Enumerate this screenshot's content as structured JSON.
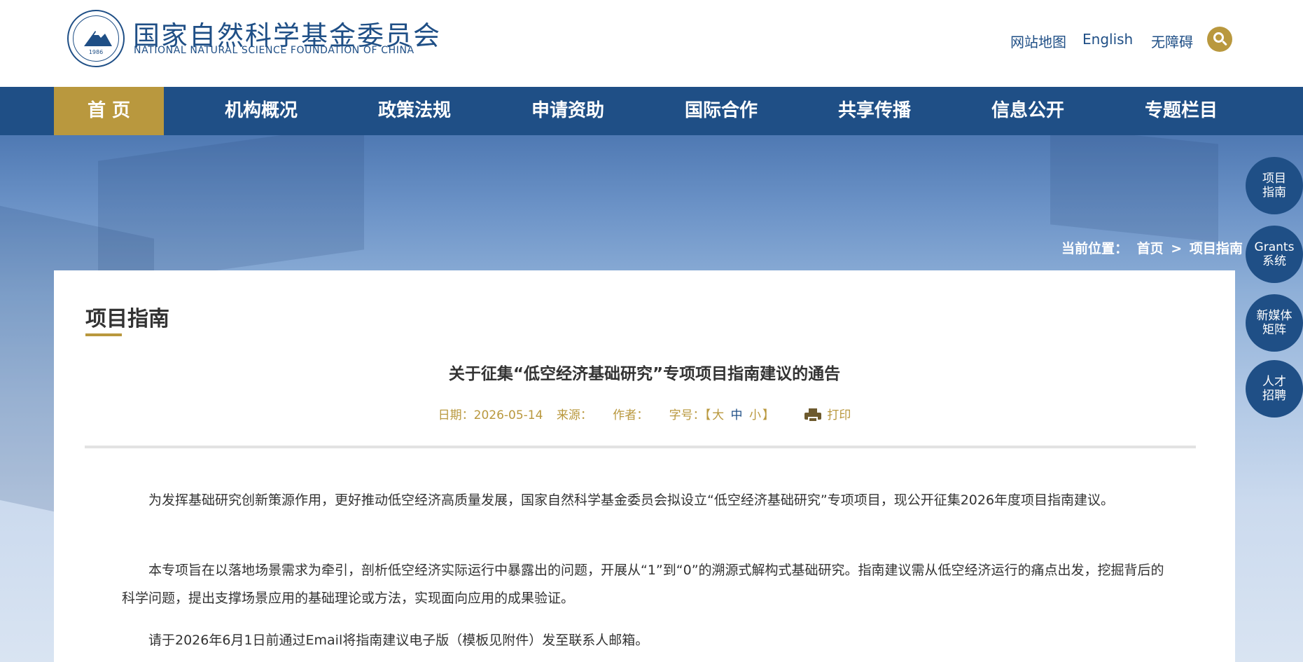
{
  "header": {
    "org_name_cn": "国家自然科学基金委员会",
    "org_name_en": "NATIONAL NATURAL SCIENCE FOUNDATION OF CHINA",
    "logo_year": "1986",
    "links": [
      "网站地图",
      "English",
      "无障碍"
    ]
  },
  "nav": {
    "items": [
      "首 页",
      "机构概况",
      "政策法规",
      "申请资助",
      "国际合作",
      "共享传播",
      "信息公开",
      "专题栏目"
    ],
    "active_index": 0
  },
  "breadcrumb": {
    "label": "当前位置：",
    "home": "首页",
    "separator": ">",
    "current": "项目指南"
  },
  "side_buttons": [
    {
      "line1": "项目",
      "line2": "指南"
    },
    {
      "line1": "Grants",
      "line2": "系统"
    },
    {
      "line1": "新媒体",
      "line2": "矩阵"
    },
    {
      "line1": "人才",
      "line2": "招聘"
    }
  ],
  "content": {
    "section_title": "项目指南",
    "article_title": "关于征集“低空经济基础研究”专项项目指南建议的通告",
    "meta": {
      "date_label": "日期：",
      "date": "2026-05-14",
      "source_label": "来源：",
      "author_label": "作者：",
      "fontsize_label": "字号：",
      "bracket_open": "【",
      "size_large": "大",
      "size_medium": "中",
      "size_small": "小",
      "bracket_close": "】",
      "print_label": "打印"
    },
    "paragraphs": [
      "为发挥基础研究创新策源作用，更好推动低空经济高质量发展，国家自然科学基金委员会拟设立“低空经济基础研究”专项项目，现公开征集2026年度项目指南建议。",
      "本专项旨在以落地场景需求为牵引，剖析低空经济实际运行中暴露出的问题，开展从“1”到“0”的溯源式解构式基础研究。指南建议需从低空经济运行的痛点出发，挖掘背后的科学问题，提出支撑场景应用的基础理论或方法，实现面向应用的成果验证。",
      "请于2026年6月1日前通过Email将指南建议电子版（模板见附件）发至联系人邮箱。"
    ]
  },
  "colors": {
    "brand_blue": "#1f4f86",
    "accent_gold": "#b9983e",
    "text_dark": "#333333"
  },
  "icons": [
    "logo-emblem",
    "search-icon",
    "print-icon"
  ]
}
